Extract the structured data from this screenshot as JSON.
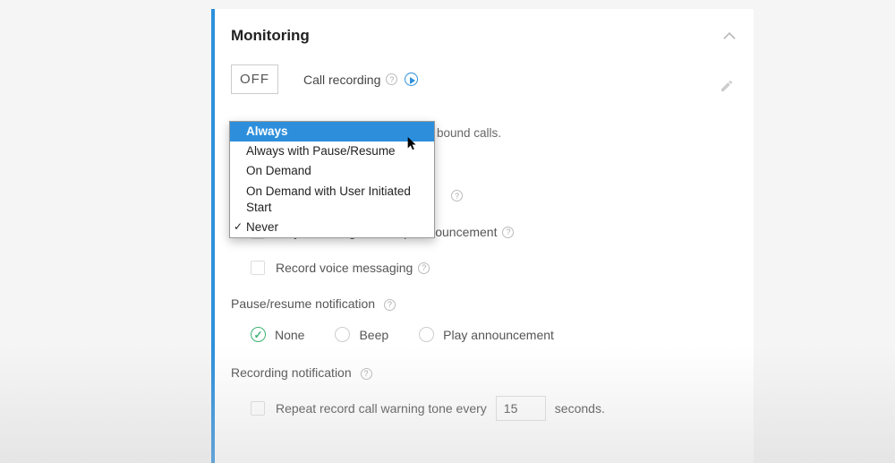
{
  "section": {
    "title": "Monitoring"
  },
  "call_recording": {
    "badge": "OFF",
    "label": "Call recording"
  },
  "partial_hint_suffix": "bound calls.",
  "dropdown": {
    "options": [
      "Always",
      "Always with Pause/Resume",
      "On Demand",
      "On Demand with User Initiated Start",
      "Never"
    ],
    "highlighted": "Always",
    "selected": "Never"
  },
  "checkboxes": {
    "announcement": "Play recording start/stop announcement",
    "voice_messaging": "Record voice messaging"
  },
  "pause_resume": {
    "title": "Pause/resume notification",
    "options": {
      "none": "None",
      "beep": "Beep",
      "play": "Play announcement"
    },
    "selected": "none"
  },
  "recording_notification": {
    "title": "Recording notification",
    "repeat_prefix": "Repeat record call warning tone every",
    "interval_value": "15",
    "repeat_suffix": "seconds."
  }
}
